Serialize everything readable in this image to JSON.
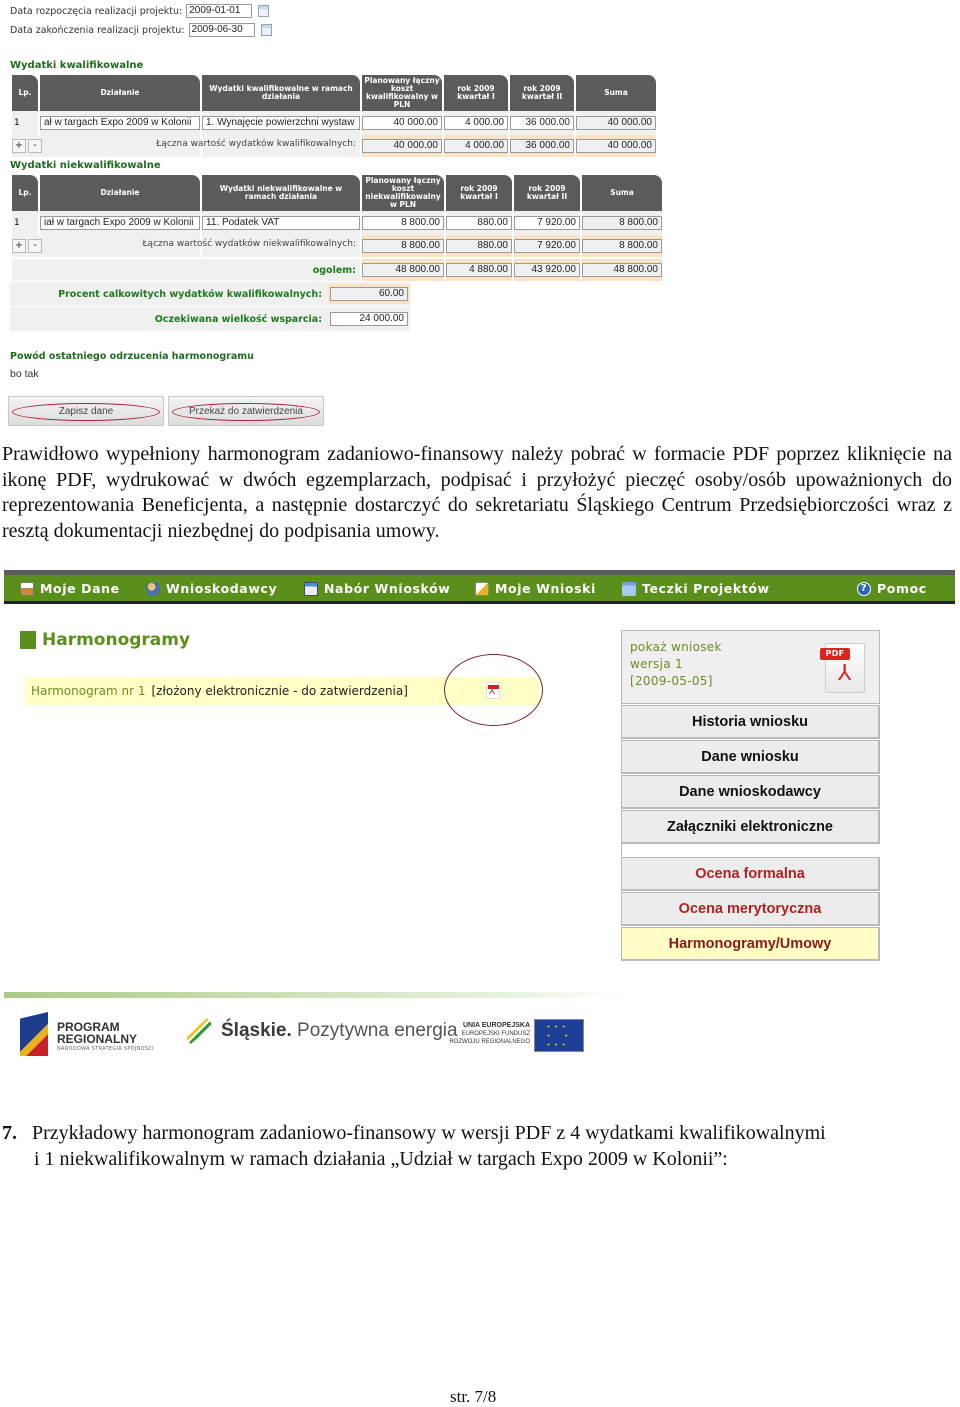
{
  "form": {
    "start_date_label": "Data rozpoczęcia realizacji projektu:",
    "start_date_value": "2009-01-01",
    "end_date_label": "Data zakończenia realizacji projektu:",
    "end_date_value": "2009-06-30",
    "qualified": {
      "title": "Wydatki kwalifikowalne",
      "headers": [
        "Lp.",
        "Działanie",
        "Wydatki kwalifikowalne w ramach działania",
        "Planowany łączny koszt kwalifikowalny w PLN",
        "rok 2009 kwartał I",
        "rok 2009 kwartał II",
        "Suma"
      ],
      "rows": [
        {
          "lp": "1",
          "action": "ał w targach Expo 2009 w Kolonii",
          "expense": "1. Wynajęcie powierzchni wystaw",
          "planned": "40 000.00",
          "q1": "4 000.00",
          "q2": "36 000.00",
          "sum": "40 000.00"
        }
      ],
      "total_label": "Łączna wartość wydatków kwalifikowalnych:",
      "totals": {
        "planned": "40 000.00",
        "q1": "4 000.00",
        "q2": "36 000.00",
        "sum": "40 000.00"
      }
    },
    "nonqualified": {
      "title": "Wydatki niekwalifikowalne",
      "headers": [
        "Lp.",
        "Działanie",
        "Wydatki niekwalifikowalne w ramach działania",
        "Planowany łączny koszt niekwalifikowalny w PLN",
        "rok 2009 kwartał I",
        "rok 2009 kwartał II",
        "Suma"
      ],
      "rows": [
        {
          "lp": "1",
          "action": "iał w targach Expo 2009 w Kolonii",
          "expense": "11. Podatek VAT",
          "planned": "8 800.00",
          "q1": "880.00",
          "q2": "7 920.00",
          "sum": "8 800.00"
        }
      ],
      "total_label": "Łączna wartość wydatków niekwalifikowalnych:",
      "totals": {
        "planned": "8 800.00",
        "q1": "880.00",
        "q2": "7 920.00",
        "sum": "8 800.00"
      }
    },
    "grand_total": {
      "label": "ogolem:",
      "planned": "48 800.00",
      "q1": "4 880.00",
      "q2": "43 920.00",
      "sum": "48 800.00"
    },
    "percent_label": "Procent calkowitych wydatków kwalifikowalnych:",
    "percent_value": "60.00",
    "support_label": "Oczekiwana wielkość wsparcia:",
    "support_value": "24 000.00",
    "plus": "+",
    "minus": "-",
    "rejection_title": "Powód ostatniego odrzucenia harmonogramu",
    "rejection_text": "bo tak",
    "save_button": "Zapisz dane",
    "submit_button": "Przekaż do zatwierdzenia"
  },
  "paragraph1": "Prawidłowo wypełniony harmonogram zadaniowo-finansowy należy pobrać w formacie PDF poprzez kliknięcie na ikonę PDF, wydrukować w dwóch egzemplarzach, podpisać i przyłożyć pieczęć osoby/osób upoważnionych do reprezentowania Beneficjenta, a następnie dostarczyć do sekretariatu Śląskiego Centrum Przedsiębiorczości wraz z resztą dokumentacji niezbędnej do podpisania umowy.",
  "nav": {
    "items": [
      {
        "label": "Moje Dane",
        "icon": "id-card-icon"
      },
      {
        "label": "Wnioskodawcy",
        "icon": "users-icon"
      },
      {
        "label": "Nabór Wniosków",
        "icon": "form-icon"
      },
      {
        "label": "Moje Wnioski",
        "icon": "edit-document-icon"
      },
      {
        "label": "Teczki Projektów",
        "icon": "folder-icon"
      },
      {
        "label": "Pomoc",
        "icon": "help-icon"
      }
    ]
  },
  "harmonogramy": {
    "title": "Harmonogramy",
    "item_link": "Harmonogram nr 1",
    "item_status": "[złożony elektronicznie - do zatwierdzenia]"
  },
  "side_panel": {
    "show_label": "pokaż wniosek",
    "version": "wersja 1",
    "date": "[2009-05-05]",
    "pdf_tag": "PDF",
    "buttons": [
      "Historia wniosku",
      "Dane wniosku",
      "Dane wnioskodawcy",
      "Załączniki elektroniczne"
    ],
    "eval_buttons": [
      "Ocena formalna",
      "Ocena merytoryczna",
      "Harmonogramy/Umowy"
    ]
  },
  "footer_logos": {
    "program": "PROGRAM\nREGIONALNY",
    "program_sub": "NARODOWA STRATEGIA SPÓJNOŚCI",
    "slaskie_bold": "Śląskie.",
    "slaskie_rest": " Pozytywna energia",
    "ue_title": "UNIA EUROPEJSKA",
    "ue_sub1": "EUROPEJSKI FUNDUSZ",
    "ue_sub2": "ROZWOJU REGIONALNEGO"
  },
  "paragraph2": {
    "number": "7.",
    "line1": "Przykładowy harmonogram zadaniowo-finansowy w wersji PDF z 4 wydatkami kwalifikowalnymi",
    "line2": "i 1 niekwalifikowalnym w ramach działania „Udział w targach Expo 2009 w Kolonii”:"
  },
  "page_number": "str. 7/8"
}
